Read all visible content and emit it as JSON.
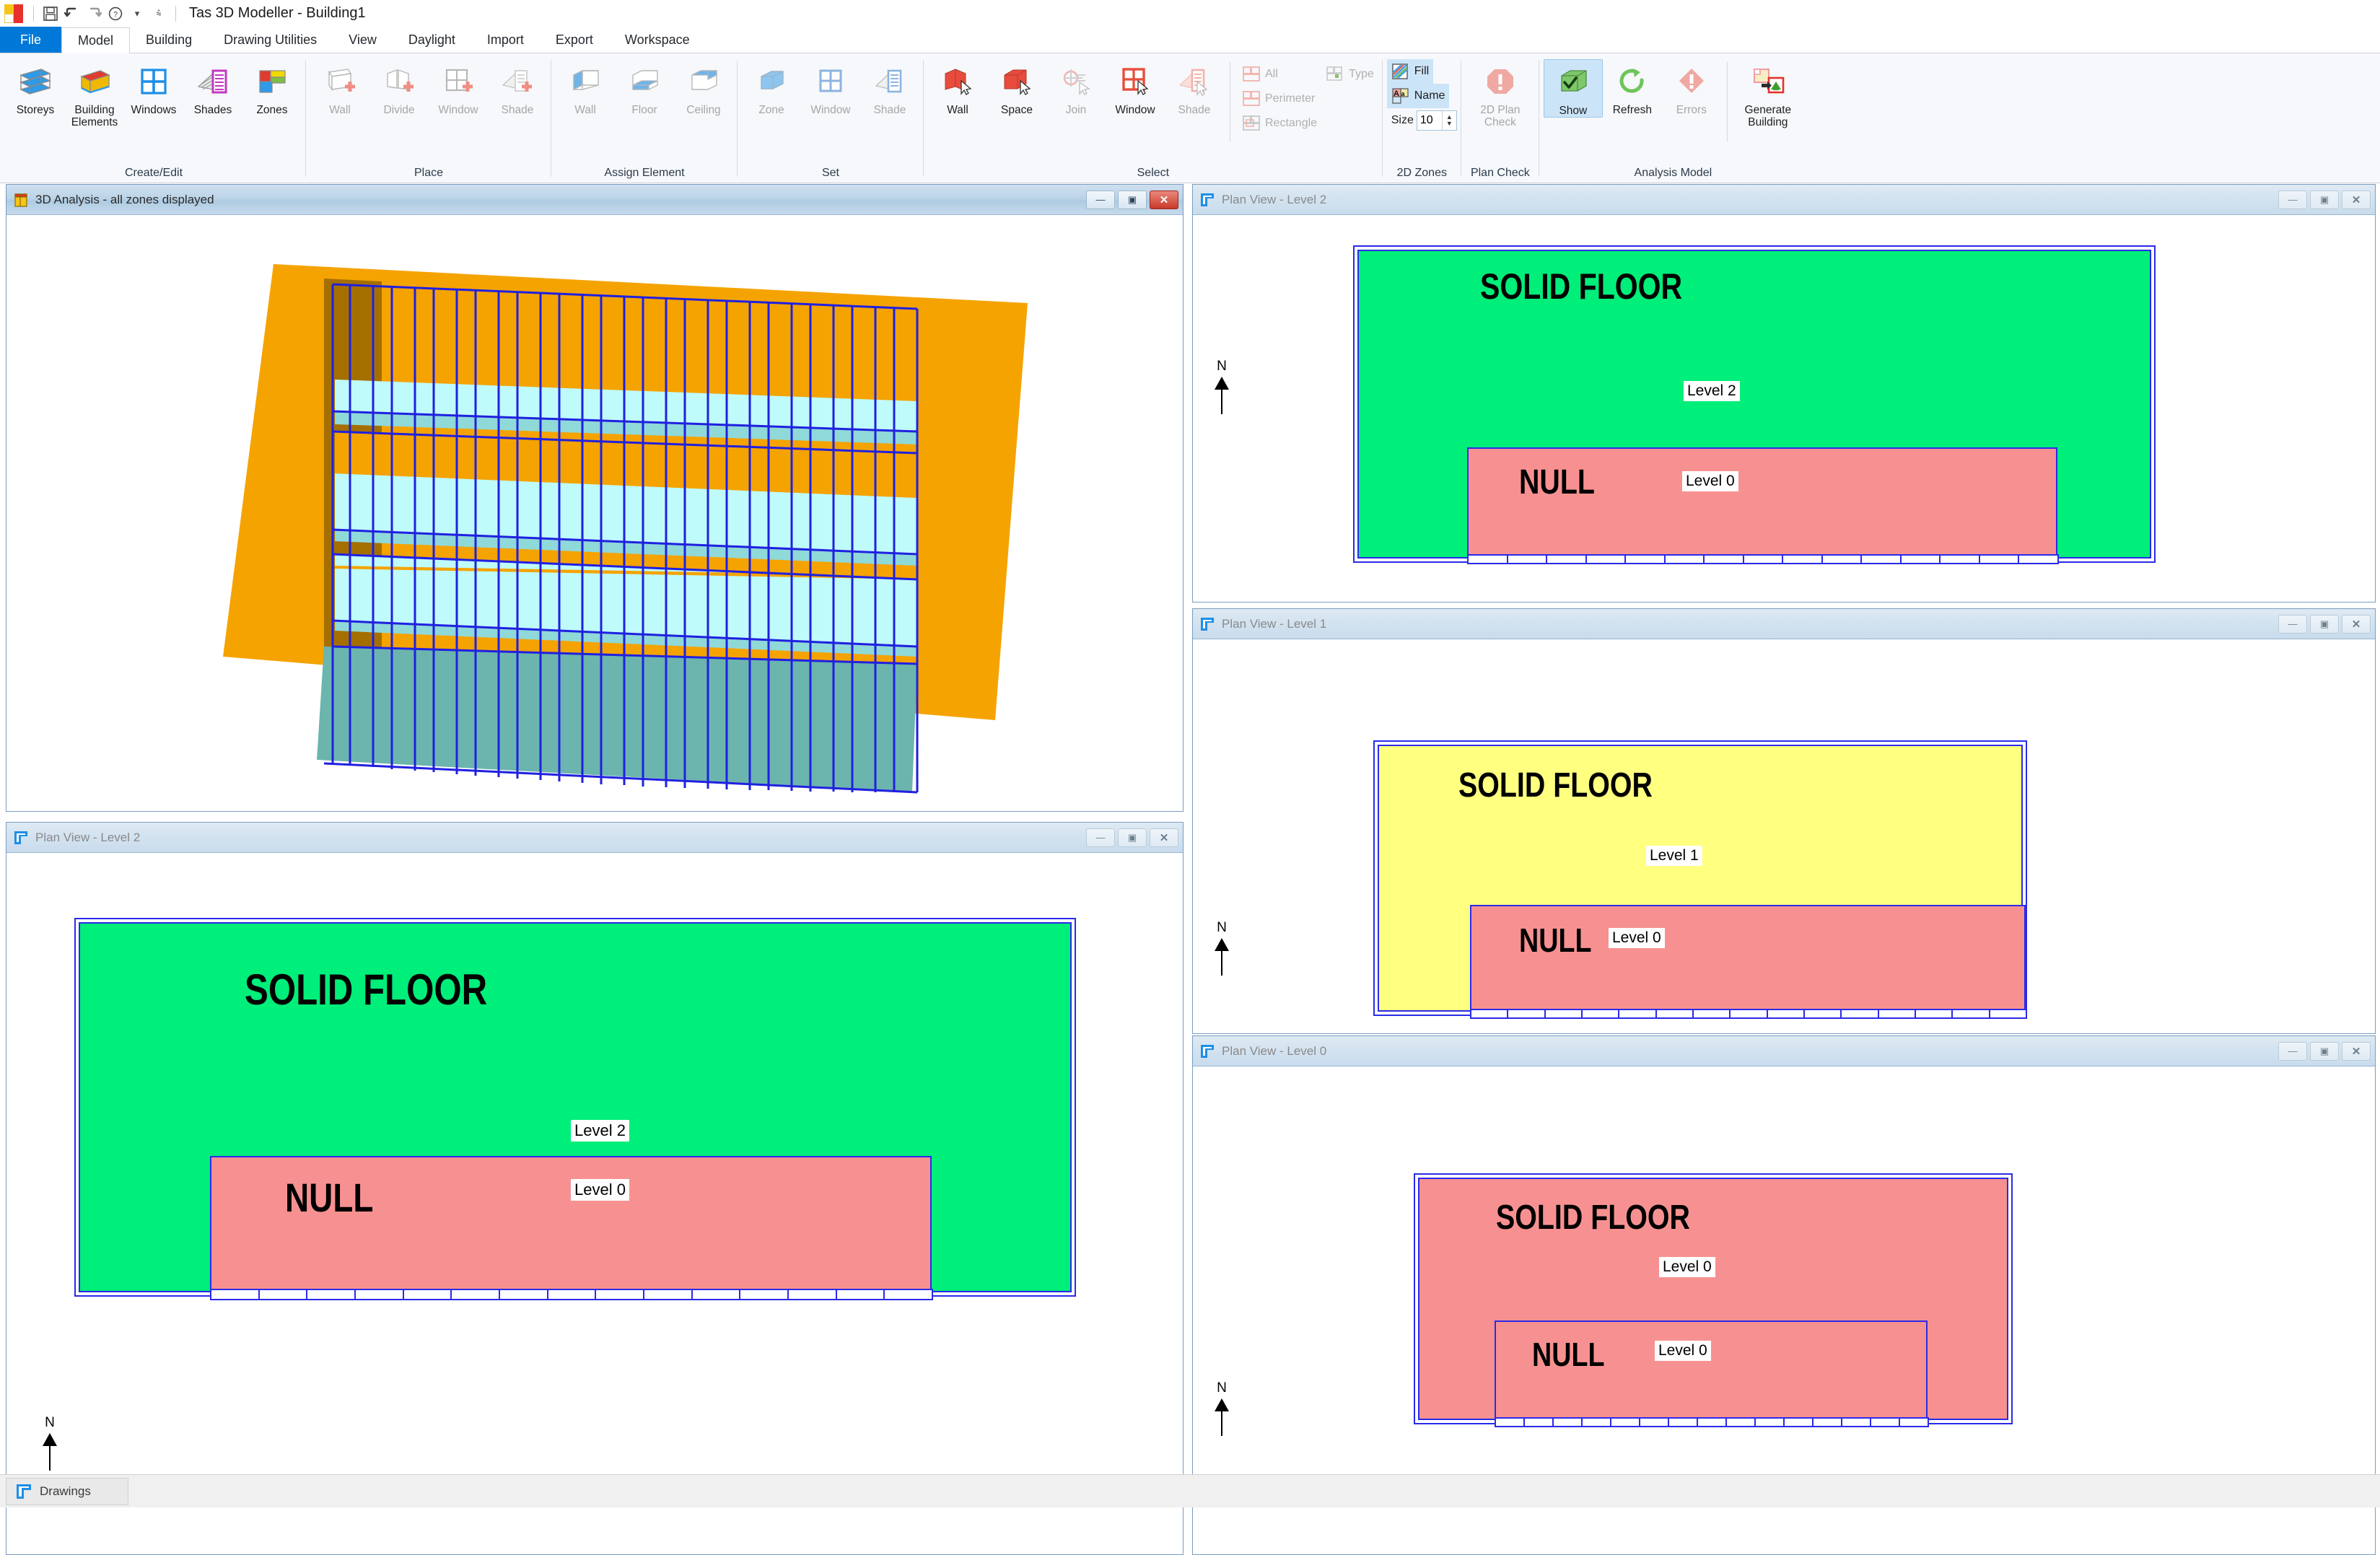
{
  "app": {
    "title": "Tas 3D Modeller - Building1",
    "logo_icon": "tas-logo-icon",
    "quick_access": [
      {
        "name": "save-icon",
        "glyph": "💾"
      },
      {
        "name": "undo-icon",
        "glyph": "↶"
      },
      {
        "name": "redo-icon",
        "glyph": "↷"
      },
      {
        "name": "help-icon",
        "glyph": "?"
      },
      {
        "name": "qat-dropdown-icon",
        "glyph": "▾"
      },
      {
        "name": "qat-customize-icon",
        "glyph": "≡"
      }
    ]
  },
  "ribbon": {
    "tabs": [
      {
        "label": "File",
        "state": "file"
      },
      {
        "label": "Model",
        "state": "active"
      },
      {
        "label": "Building",
        "state": "normal"
      },
      {
        "label": "Drawing Utilities",
        "state": "normal"
      },
      {
        "label": "View",
        "state": "normal"
      },
      {
        "label": "Daylight",
        "state": "normal"
      },
      {
        "label": "Import",
        "state": "normal"
      },
      {
        "label": "Export",
        "state": "normal"
      },
      {
        "label": "Workspace",
        "state": "normal"
      }
    ],
    "groups": [
      {
        "label": "Create/Edit",
        "buttons": [
          {
            "label": "Storeys",
            "icon": "storeys-icon",
            "disabled": false
          },
          {
            "label": "Building Elements",
            "icon": "building-elements-icon",
            "disabled": false
          },
          {
            "label": "Windows",
            "icon": "windows-icon",
            "disabled": false
          },
          {
            "label": "Shades",
            "icon": "shades-icon",
            "disabled": false
          },
          {
            "label": "Zones",
            "icon": "zones-icon",
            "disabled": false
          }
        ]
      },
      {
        "label": "Place",
        "buttons": [
          {
            "label": "Wall",
            "icon": "place-wall-icon",
            "disabled": true
          },
          {
            "label": "Divide",
            "icon": "place-divide-icon",
            "disabled": true
          },
          {
            "label": "Window",
            "icon": "place-window-icon",
            "disabled": true
          },
          {
            "label": "Shade",
            "icon": "place-shade-icon",
            "disabled": true
          }
        ]
      },
      {
        "label": "Assign Element",
        "buttons": [
          {
            "label": "Wall",
            "icon": "assign-wall-icon",
            "disabled": true
          },
          {
            "label": "Floor",
            "icon": "assign-floor-icon",
            "disabled": true
          },
          {
            "label": "Ceiling",
            "icon": "assign-ceiling-icon",
            "disabled": true
          }
        ]
      },
      {
        "label": "Set",
        "buttons": [
          {
            "label": "Zone",
            "icon": "set-zone-icon",
            "disabled": true
          },
          {
            "label": "Window",
            "icon": "set-window-icon",
            "disabled": true
          },
          {
            "label": "Shade",
            "icon": "set-shade-icon",
            "disabled": true
          }
        ]
      },
      {
        "label": "Select",
        "buttons": [
          {
            "label": "Wall",
            "icon": "select-wall-icon",
            "disabled": false
          },
          {
            "label": "Space",
            "icon": "select-space-icon",
            "disabled": false
          },
          {
            "label": "Join",
            "icon": "select-join-icon",
            "disabled": true
          },
          {
            "label": "Window",
            "icon": "select-window-icon",
            "disabled": false
          },
          {
            "label": "Shade",
            "icon": "select-shade-icon",
            "disabled": true
          }
        ],
        "mini_left": [
          {
            "label": "All",
            "icon": "select-all-icon",
            "disabled": true
          },
          {
            "label": "Perimeter",
            "icon": "select-perimeter-icon",
            "disabled": true
          },
          {
            "label": "Rectangle",
            "icon": "select-rectangle-icon",
            "disabled": true
          }
        ],
        "mini_right": [
          {
            "label": "Type",
            "icon": "select-type-icon",
            "disabled": true
          }
        ]
      },
      {
        "label": "2D Zones",
        "mini": [
          {
            "label": "Fill",
            "icon": "fill-icon",
            "checked": true
          },
          {
            "label": "Name",
            "icon": "name-icon",
            "checked": true
          }
        ],
        "size": {
          "label": "Size",
          "value": "10"
        }
      },
      {
        "label": "Plan Check",
        "buttons": [
          {
            "label": "2D Plan Check",
            "icon": "plan-check-icon",
            "disabled": true
          }
        ]
      },
      {
        "label": "Analysis Model",
        "buttons": [
          {
            "label": "Show",
            "icon": "show-icon",
            "disabled": false,
            "checked": true
          },
          {
            "label": "Refresh",
            "icon": "refresh-icon",
            "disabled": false
          },
          {
            "label": "Errors",
            "icon": "errors-icon",
            "disabled": true
          },
          {
            "label": "Generate Building",
            "icon": "generate-building-icon",
            "disabled": false
          }
        ]
      }
    ]
  },
  "colors": {
    "zone_green": "#00EE7A",
    "zone_pink": "#F79191",
    "zone_yellow": "#FFFF80",
    "outline_blue": "#2A2AE8",
    "facade_orange": "#F5A300",
    "slab_cyan": "#BFFBFB",
    "ground_teal": "#6BB5AE",
    "file_tab_blue": "#0078D7"
  },
  "windows": {
    "view3d": {
      "title": "3D Analysis - all zones displayed",
      "icon": "tas-3d-icon",
      "active": true,
      "controls": [
        {
          "name": "minimize-button",
          "glyph": "—"
        },
        {
          "name": "restore-button",
          "glyph": "▣"
        },
        {
          "name": "close-button",
          "glyph": "✕"
        }
      ]
    },
    "plan_views": [
      {
        "id": "plan-level-2-left",
        "title": "Plan View - Level 2",
        "icon": "plan-view-icon",
        "active": false,
        "north_label": "N",
        "zones": [
          {
            "name": "SOLID FLOOR",
            "tag": "Level 2",
            "fill": "#00EE7A"
          },
          {
            "name": "NULL",
            "tag": "Level 0",
            "fill": "#F79191"
          }
        ],
        "controls": [
          {
            "name": "minimize-button",
            "glyph": "—"
          },
          {
            "name": "restore-button",
            "glyph": "▣"
          },
          {
            "name": "close-button",
            "glyph": "✕"
          }
        ]
      },
      {
        "id": "plan-level-2-right",
        "title": "Plan View - Level 2",
        "icon": "plan-view-icon",
        "active": false,
        "north_label": "N",
        "zones": [
          {
            "name": "SOLID FLOOR",
            "tag": "Level 2",
            "fill": "#00EE7A"
          },
          {
            "name": "NULL",
            "tag": "Level 0",
            "fill": "#F79191"
          }
        ],
        "controls": [
          {
            "name": "minimize-button",
            "glyph": "—"
          },
          {
            "name": "restore-button",
            "glyph": "▣"
          },
          {
            "name": "close-button",
            "glyph": "✕"
          }
        ]
      },
      {
        "id": "plan-level-1",
        "title": "Plan View - Level 1",
        "icon": "plan-view-icon",
        "active": false,
        "north_label": "N",
        "zones": [
          {
            "name": "SOLID FLOOR",
            "tag": "Level 1",
            "fill": "#FFFF80"
          },
          {
            "name": "NULL",
            "tag": "Level 0",
            "fill": "#F79191"
          }
        ],
        "controls": [
          {
            "name": "minimize-button",
            "glyph": "—"
          },
          {
            "name": "restore-button",
            "glyph": "▣"
          },
          {
            "name": "close-button",
            "glyph": "✕"
          }
        ]
      },
      {
        "id": "plan-level-0",
        "title": "Plan View - Level 0",
        "icon": "plan-view-icon",
        "active": false,
        "north_label": "N",
        "zones": [
          {
            "name": "SOLID FLOOR",
            "tag": "Level 0",
            "fill": "#F79191"
          },
          {
            "name": "NULL",
            "tag": "Level 0",
            "fill": "#F79191"
          }
        ],
        "controls": [
          {
            "name": "minimize-button",
            "glyph": "—"
          },
          {
            "name": "restore-button",
            "glyph": "▣"
          },
          {
            "name": "close-button",
            "glyph": "✕"
          }
        ]
      }
    ]
  },
  "taskbar": {
    "buttons": [
      {
        "label": "Drawings",
        "icon": "drawings-icon"
      }
    ]
  }
}
